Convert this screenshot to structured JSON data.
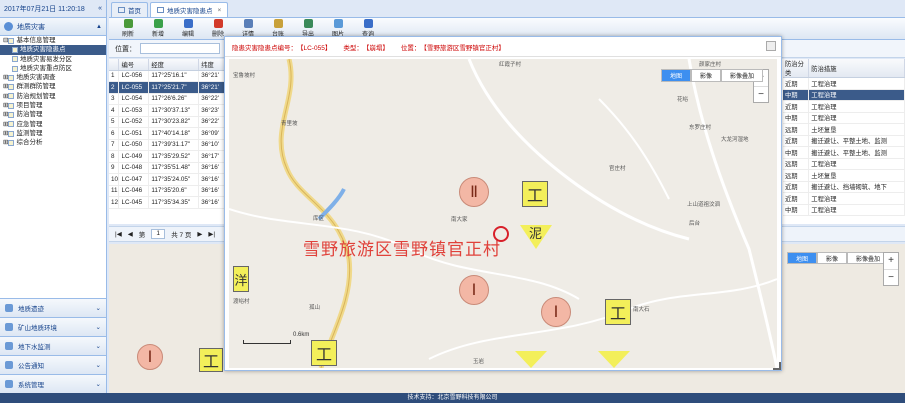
{
  "app": {
    "datetime": "2017年07月21日 11:20:18",
    "collapse_glyph": "«",
    "panel_title": "地质灾害",
    "footer": "技术支持：北京雪野科技有限公司"
  },
  "sidebar": {
    "tree": [
      {
        "label": "基本信息管理",
        "level": 0,
        "expanded": true
      },
      {
        "label": "地质灾害隐患点",
        "level": 1,
        "selected": true
      },
      {
        "label": "地质灾害易发分区",
        "level": 1
      },
      {
        "label": "地质灾害重点防区",
        "level": 1
      },
      {
        "label": "地质灾害调查",
        "level": 0
      },
      {
        "label": "群测群防管理",
        "level": 0
      },
      {
        "label": "防治规划管理",
        "level": 0
      },
      {
        "label": "项目管理",
        "level": 0
      },
      {
        "label": "防治管理",
        "level": 0
      },
      {
        "label": "应急管理",
        "level": 0
      },
      {
        "label": "监测管理",
        "level": 0
      },
      {
        "label": "综合分析",
        "level": 0
      }
    ],
    "accordion": [
      {
        "label": "地质遗迹"
      },
      {
        "label": "矿山地质环境"
      },
      {
        "label": "地下水监测"
      },
      {
        "label": "公告通知"
      },
      {
        "label": "系统管理"
      }
    ]
  },
  "tabs": [
    {
      "label": "首页",
      "active": false
    },
    {
      "label": "地质灾害隐患点",
      "active": true
    }
  ],
  "toolbar": [
    {
      "label": "刷新",
      "color": "#4a9a3a"
    },
    {
      "label": "新增",
      "color": "#3aa14a"
    },
    {
      "label": "编辑",
      "color": "#3a6ec8"
    },
    {
      "label": "删除",
      "color": "#d23a2a"
    },
    {
      "label": "详情",
      "color": "#5a7fb8"
    },
    {
      "label": "台账",
      "color": "#c8a13a"
    },
    {
      "label": "导出",
      "color": "#3a8a5a"
    },
    {
      "label": "图片",
      "color": "#5a9ad8"
    },
    {
      "label": "查询",
      "color": "#3a6ec8"
    }
  ],
  "search": {
    "label": "位置："
  },
  "grid": {
    "headers_left": [
      "",
      "编号",
      "经度",
      "纬度"
    ],
    "headers_right": [
      "防治分类",
      "防治措施"
    ],
    "rows": [
      {
        "n": "1",
        "id": "LC-056",
        "lon": "117°25'16.1\"",
        "lat": "36°21'",
        "cls": "近期",
        "measure": "工程治理",
        "selected": false
      },
      {
        "n": "2",
        "id": "LC-055",
        "lon": "117°25'21.7\"",
        "lat": "36°21'",
        "cls": "中期",
        "measure": "工程治理",
        "selected": true
      },
      {
        "n": "3",
        "id": "LC-054",
        "lon": "117°26'6.26\"",
        "lat": "36°22'",
        "cls": "近期",
        "measure": "工程治理",
        "selected": false
      },
      {
        "n": "4",
        "id": "LC-053",
        "lon": "117°30'37.13\"",
        "lat": "36°23'",
        "cls": "中期",
        "measure": "工程治理",
        "selected": false
      },
      {
        "n": "5",
        "id": "LC-052",
        "lon": "117°30'23.82\"",
        "lat": "36°22'",
        "cls": "远期",
        "measure": "土坯复垦",
        "selected": false
      },
      {
        "n": "6",
        "id": "LC-051",
        "lon": "117°40'14.18\"",
        "lat": "36°09'",
        "cls": "近期",
        "measure": "搬迁避让、平整土地、监测",
        "selected": false
      },
      {
        "n": "7",
        "id": "LC-050",
        "lon": "117°39'31.17\"",
        "lat": "36°10'",
        "cls": "中期",
        "measure": "搬迁避让、平整土地、监测",
        "selected": false
      },
      {
        "n": "8",
        "id": "LC-049",
        "lon": "117°35'29.52\"",
        "lat": "36°17'",
        "cls": "远期",
        "measure": "工程治理",
        "selected": false
      },
      {
        "n": "9",
        "id": "LC-048",
        "lon": "117°35'51.48\"",
        "lat": "36°16'",
        "cls": "远期",
        "measure": "土坯复垦",
        "selected": false
      },
      {
        "n": "10",
        "id": "LC-047",
        "lon": "117°35'24.05\"",
        "lat": "36°16'",
        "cls": "近期",
        "measure": "搬迁避让、挡墙砌筑、地下",
        "selected": false
      },
      {
        "n": "11",
        "id": "LC-046",
        "lon": "117°35'20.6\"",
        "lat": "36°16'",
        "cls": "近期",
        "measure": "工程治理",
        "selected": false
      },
      {
        "n": "12",
        "id": "LC-045",
        "lon": "117°35'34.35\"",
        "lat": "36°16'",
        "cls": "中期",
        "measure": "工程治理",
        "selected": false
      }
    ]
  },
  "pager": {
    "first": "|◀",
    "prev": "◀",
    "page_label": "第",
    "page": "1",
    "of": "共 7 页",
    "next": "▶",
    "last": "▶|"
  },
  "dialog": {
    "name_label": "隐患灾害隐患点编号：",
    "name_value": "【LC-055】",
    "type_label": "类型：",
    "type_value": "【崩塌】",
    "loc_label": "位置：",
    "loc_value": "【雪野旅游区雪野镇官正村】",
    "big_label": "雪野旅游区雪野镇官正村",
    "scale": "0.6km"
  },
  "map": {
    "tabs": [
      {
        "label": "地图",
        "on": true
      },
      {
        "label": "影像",
        "on": false
      },
      {
        "label": "影像叠加",
        "on": false
      }
    ],
    "zoom_in": "+",
    "zoom_out": "−",
    "labels": [
      "宝鲁坡村",
      "青里坡",
      "红霞子村",
      "颜家庄村",
      "花峪",
      "官庄村",
      "东罗庄村",
      "大龙河湿地",
      "上山道祖汶泗",
      "库区",
      "南大家",
      "后台",
      "渡峪村",
      "孤山",
      "南大石",
      "玉岩"
    ],
    "circle_glyphs": [
      "Ⅱ",
      "Ⅰ",
      "Ⅰ",
      "Ⅰ",
      "Ⅰ"
    ],
    "square_glyph": "工",
    "tri_glyph": "泥",
    "side_glyph": "洋"
  }
}
